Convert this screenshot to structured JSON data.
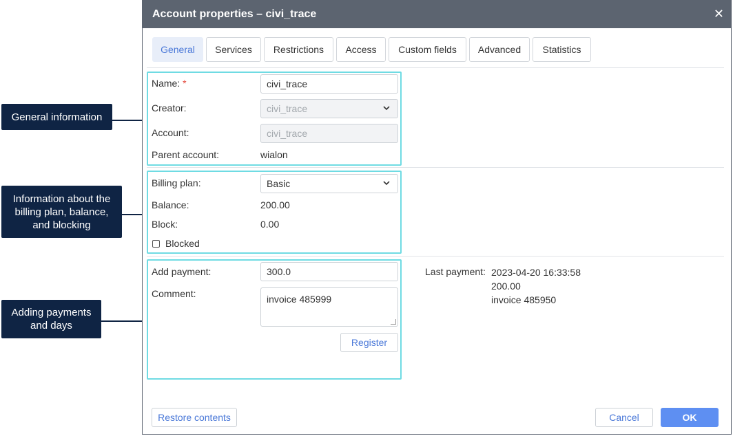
{
  "dialog": {
    "title": "Account properties – civi_trace",
    "close_glyph": "✕"
  },
  "tabs": [
    {
      "label": "General",
      "active": true
    },
    {
      "label": "Services",
      "active": false
    },
    {
      "label": "Restrictions",
      "active": false
    },
    {
      "label": "Access",
      "active": false
    },
    {
      "label": "Custom fields",
      "active": false
    },
    {
      "label": "Advanced",
      "active": false
    },
    {
      "label": "Statistics",
      "active": false
    }
  ],
  "general": {
    "name_label": "Name:",
    "required_mark": "*",
    "name_value": "civi_trace",
    "creator_label": "Creator:",
    "creator_value": "civi_trace",
    "account_label": "Account:",
    "account_value": "civi_trace",
    "parent_label": "Parent account:",
    "parent_value": "wialon"
  },
  "billing": {
    "plan_label": "Billing plan:",
    "plan_value": "Basic",
    "balance_label": "Balance:",
    "balance_value": "200.00",
    "block_label": "Block:",
    "block_value": "0.00",
    "blocked_label": "Blocked",
    "blocked_checked": false
  },
  "payment": {
    "add_label": "Add payment:",
    "add_value": "300.0",
    "comment_label": "Comment:",
    "comment_value": "invoice 485999",
    "register_label": "Register",
    "last_label": "Last payment:",
    "last_date": "2023-04-20 16:33:58",
    "last_amount": "200.00",
    "last_comment": "invoice 485950"
  },
  "footer": {
    "restore_label": "Restore contents",
    "cancel_label": "Cancel",
    "ok_label": "OK"
  },
  "callouts": {
    "general": "General information",
    "billing": "Information about the billing plan, balance, and blocking",
    "payments": "Adding payments and days"
  },
  "colors": {
    "titlebar": "#5c6470",
    "accent": "#4a78d8",
    "primary_button": "#5e8ff2",
    "highlight_box": "#6fdbe3",
    "callout_bg": "#0f2444",
    "required": "#e4483b"
  },
  "icons": {
    "dropdown": "chevron-down-icon",
    "close": "close-icon"
  }
}
